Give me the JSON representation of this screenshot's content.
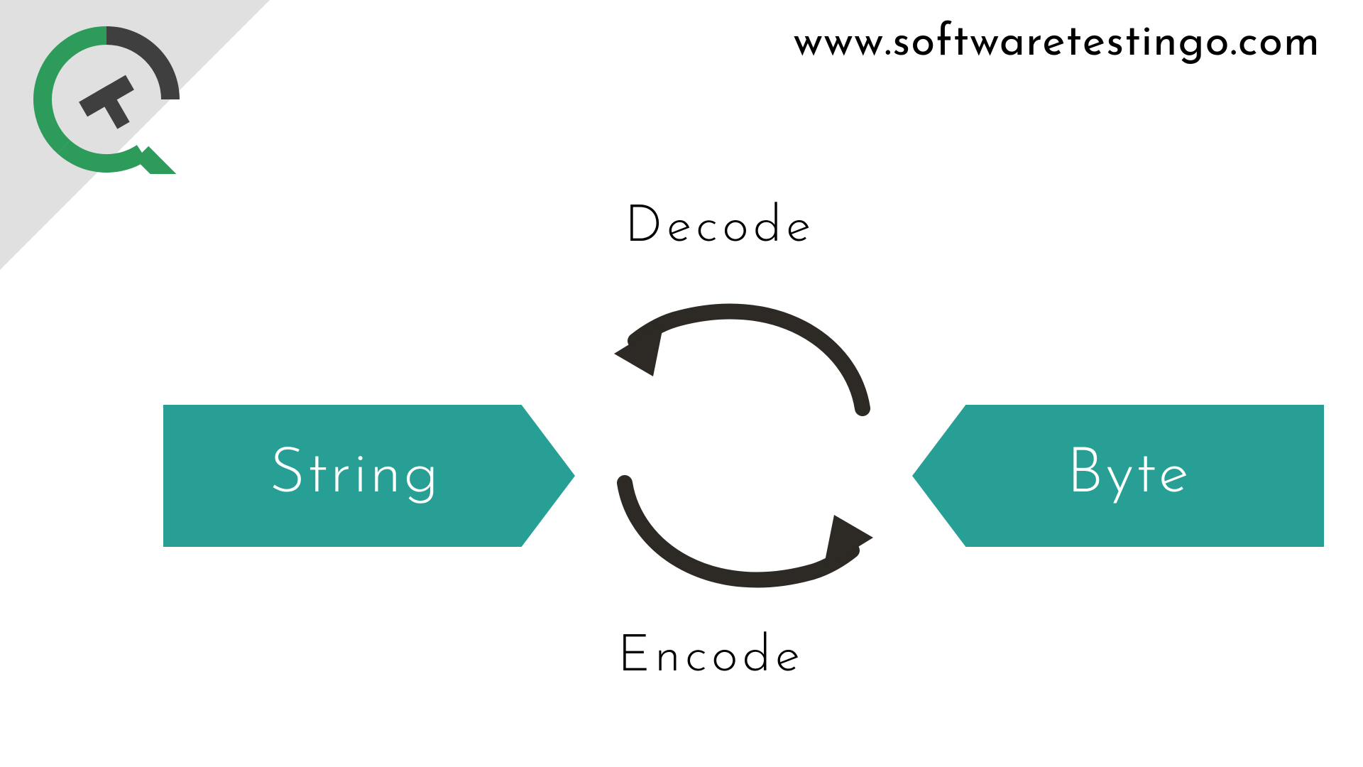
{
  "header": {
    "url": "www.softwaretestingo.com"
  },
  "diagram": {
    "left_box": "String",
    "right_box": "Byte",
    "top_label": "Decode",
    "bottom_label": "Encode"
  },
  "colors": {
    "teal": "#289f94",
    "gray": "#e0e0e0",
    "dark_gray": "#3f3f3f",
    "green": "#2d9b5a",
    "arrow": "#2d2924"
  }
}
